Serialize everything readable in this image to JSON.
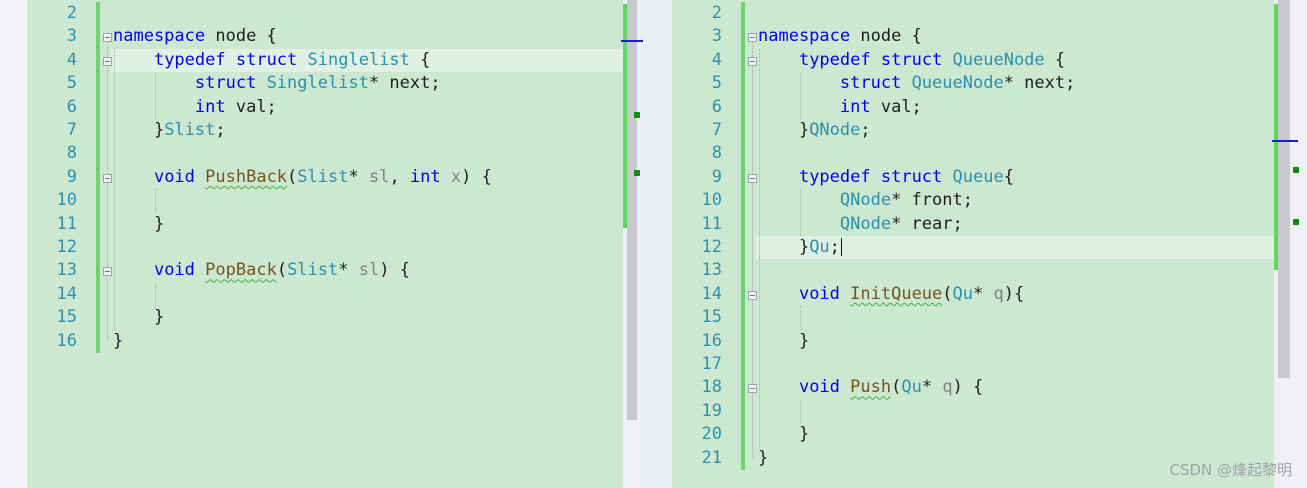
{
  "left": {
    "lines": [
      {
        "n": "2",
        "segs": []
      },
      {
        "n": "3",
        "segs": [
          {
            "c": "k",
            "t": "namespace"
          },
          {
            "c": "",
            "t": " node {"
          }
        ]
      },
      {
        "n": "4",
        "segs": [
          {
            "c": "",
            "t": "    "
          },
          {
            "c": "k",
            "t": "typedef"
          },
          {
            "c": "",
            "t": " "
          },
          {
            "c": "k",
            "t": "struct"
          },
          {
            "c": "",
            "t": " "
          },
          {
            "c": "t",
            "t": "Singlelist"
          },
          {
            "c": "",
            "t": " {"
          }
        ]
      },
      {
        "n": "5",
        "segs": [
          {
            "c": "",
            "t": "        "
          },
          {
            "c": "k",
            "t": "struct"
          },
          {
            "c": "",
            "t": " "
          },
          {
            "c": "t",
            "t": "Singlelist"
          },
          {
            "c": "",
            "t": "* next;"
          }
        ]
      },
      {
        "n": "6",
        "segs": [
          {
            "c": "",
            "t": "        "
          },
          {
            "c": "k",
            "t": "int"
          },
          {
            "c": "",
            "t": " val;"
          }
        ]
      },
      {
        "n": "7",
        "segs": [
          {
            "c": "",
            "t": "    }"
          },
          {
            "c": "t",
            "t": "Slist"
          },
          {
            "c": "",
            "t": ";"
          }
        ]
      },
      {
        "n": "8",
        "segs": []
      },
      {
        "n": "9",
        "segs": [
          {
            "c": "",
            "t": "    "
          },
          {
            "c": "k",
            "t": "void"
          },
          {
            "c": "",
            "t": " "
          },
          {
            "c": "fn sq",
            "t": "PushBack"
          },
          {
            "c": "",
            "t": "("
          },
          {
            "c": "t",
            "t": "Slist"
          },
          {
            "c": "",
            "t": "* "
          },
          {
            "c": "p",
            "t": "sl"
          },
          {
            "c": "",
            "t": ", "
          },
          {
            "c": "k",
            "t": "int"
          },
          {
            "c": "",
            "t": " "
          },
          {
            "c": "p",
            "t": "x"
          },
          {
            "c": "",
            "t": ") {"
          }
        ]
      },
      {
        "n": "10",
        "segs": []
      },
      {
        "n": "11",
        "segs": [
          {
            "c": "",
            "t": "    }"
          }
        ]
      },
      {
        "n": "12",
        "segs": []
      },
      {
        "n": "13",
        "segs": [
          {
            "c": "",
            "t": "    "
          },
          {
            "c": "k",
            "t": "void"
          },
          {
            "c": "",
            "t": " "
          },
          {
            "c": "fn sq",
            "t": "PopBack"
          },
          {
            "c": "",
            "t": "("
          },
          {
            "c": "t",
            "t": "Slist"
          },
          {
            "c": "",
            "t": "* "
          },
          {
            "c": "p",
            "t": "sl"
          },
          {
            "c": "",
            "t": ") {"
          }
        ]
      },
      {
        "n": "14",
        "segs": []
      },
      {
        "n": "15",
        "segs": [
          {
            "c": "",
            "t": "    }"
          }
        ]
      },
      {
        "n": "16",
        "segs": [
          {
            "c": "",
            "t": "}"
          }
        ]
      }
    ]
  },
  "right": {
    "lines": [
      {
        "n": "2",
        "segs": []
      },
      {
        "n": "3",
        "segs": [
          {
            "c": "k",
            "t": "namespace"
          },
          {
            "c": "",
            "t": " node {"
          }
        ]
      },
      {
        "n": "4",
        "segs": [
          {
            "c": "",
            "t": "    "
          },
          {
            "c": "k",
            "t": "typedef"
          },
          {
            "c": "",
            "t": " "
          },
          {
            "c": "k",
            "t": "struct"
          },
          {
            "c": "",
            "t": " "
          },
          {
            "c": "t",
            "t": "QueueNode"
          },
          {
            "c": "",
            "t": " {"
          }
        ]
      },
      {
        "n": "5",
        "segs": [
          {
            "c": "",
            "t": "        "
          },
          {
            "c": "k",
            "t": "struct"
          },
          {
            "c": "",
            "t": " "
          },
          {
            "c": "t",
            "t": "QueueNode"
          },
          {
            "c": "",
            "t": "* next;"
          }
        ]
      },
      {
        "n": "6",
        "segs": [
          {
            "c": "",
            "t": "        "
          },
          {
            "c": "k",
            "t": "int"
          },
          {
            "c": "",
            "t": " val;"
          }
        ]
      },
      {
        "n": "7",
        "segs": [
          {
            "c": "",
            "t": "    }"
          },
          {
            "c": "t",
            "t": "QNode"
          },
          {
            "c": "",
            "t": ";"
          }
        ]
      },
      {
        "n": "8",
        "segs": []
      },
      {
        "n": "9",
        "segs": [
          {
            "c": "",
            "t": "    "
          },
          {
            "c": "k",
            "t": "typedef"
          },
          {
            "c": "",
            "t": " "
          },
          {
            "c": "k",
            "t": "struct"
          },
          {
            "c": "",
            "t": " "
          },
          {
            "c": "t",
            "t": "Queue"
          },
          {
            "c": "",
            "t": "{"
          }
        ]
      },
      {
        "n": "10",
        "segs": [
          {
            "c": "",
            "t": "        "
          },
          {
            "c": "t",
            "t": "QNode"
          },
          {
            "c": "",
            "t": "* front;"
          }
        ]
      },
      {
        "n": "11",
        "segs": [
          {
            "c": "",
            "t": "        "
          },
          {
            "c": "t",
            "t": "QNode"
          },
          {
            "c": "",
            "t": "* rear;"
          }
        ]
      },
      {
        "n": "12",
        "segs": [
          {
            "c": "",
            "t": "    }"
          },
          {
            "c": "t",
            "t": "Qu"
          },
          {
            "c": "",
            "t": ";"
          },
          {
            "c": "caret",
            "t": ""
          }
        ]
      },
      {
        "n": "13",
        "segs": []
      },
      {
        "n": "14",
        "segs": [
          {
            "c": "",
            "t": "    "
          },
          {
            "c": "k",
            "t": "void"
          },
          {
            "c": "",
            "t": " "
          },
          {
            "c": "fn sq",
            "t": "InitQueue"
          },
          {
            "c": "",
            "t": "("
          },
          {
            "c": "t",
            "t": "Qu"
          },
          {
            "c": "",
            "t": "* "
          },
          {
            "c": "p",
            "t": "q"
          },
          {
            "c": "",
            "t": "){"
          }
        ]
      },
      {
        "n": "15",
        "segs": []
      },
      {
        "n": "16",
        "segs": [
          {
            "c": "",
            "t": "    }"
          }
        ]
      },
      {
        "n": "17",
        "segs": []
      },
      {
        "n": "18",
        "segs": [
          {
            "c": "",
            "t": "    "
          },
          {
            "c": "k",
            "t": "void"
          },
          {
            "c": "",
            "t": " "
          },
          {
            "c": "fn sq",
            "t": "Push"
          },
          {
            "c": "",
            "t": "("
          },
          {
            "c": "t",
            "t": "Qu"
          },
          {
            "c": "",
            "t": "* "
          },
          {
            "c": "p",
            "t": "q"
          },
          {
            "c": "",
            "t": ") {"
          }
        ]
      },
      {
        "n": "19",
        "segs": []
      },
      {
        "n": "20",
        "segs": [
          {
            "c": "",
            "t": "    }"
          }
        ]
      },
      {
        "n": "21",
        "segs": [
          {
            "c": "",
            "t": "}"
          }
        ]
      }
    ]
  },
  "watermark": "CSDN @烽起黎明",
  "colors": {
    "editor_bg": "#cde8d0",
    "keyword": "#0000ff",
    "type": "#2b91af",
    "function": "#74531f",
    "change_bar": "#6fd36f"
  }
}
